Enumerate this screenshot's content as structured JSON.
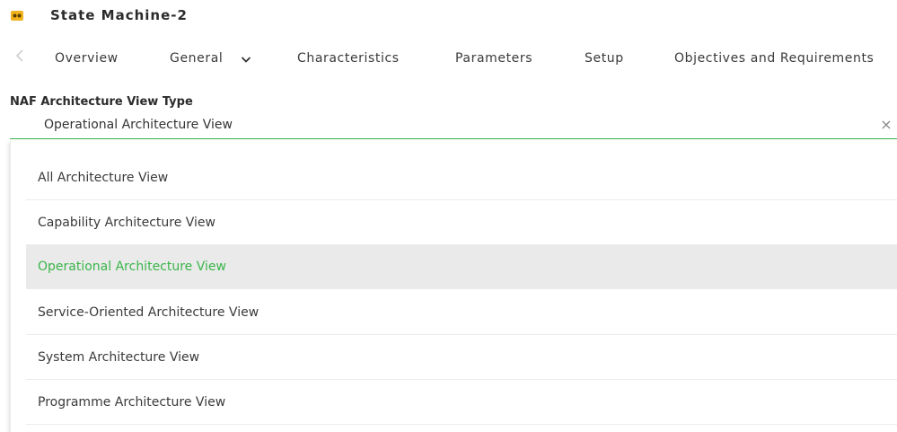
{
  "app": {
    "title": "State Machine-2",
    "icon": "state-machine-icon",
    "accent": "#3ab54a"
  },
  "tabs": {
    "items": [
      {
        "label": "Overview"
      },
      {
        "label": "General"
      },
      {
        "label": "Characteristics"
      },
      {
        "label": "Parameters"
      },
      {
        "label": "Setup"
      },
      {
        "label": "Objectives and Requirements"
      }
    ]
  },
  "field": {
    "label": "NAF Architecture View Type",
    "value": "Operational Architecture View",
    "clear_icon": "×"
  },
  "options": [
    {
      "label": "All Architecture View"
    },
    {
      "label": "Capability Architecture View"
    },
    {
      "label": "Operational Architecture View",
      "selected": true
    },
    {
      "label": "Service-Oriented Architecture View"
    },
    {
      "label": "System Architecture View"
    },
    {
      "label": "Programme Architecture View"
    }
  ]
}
